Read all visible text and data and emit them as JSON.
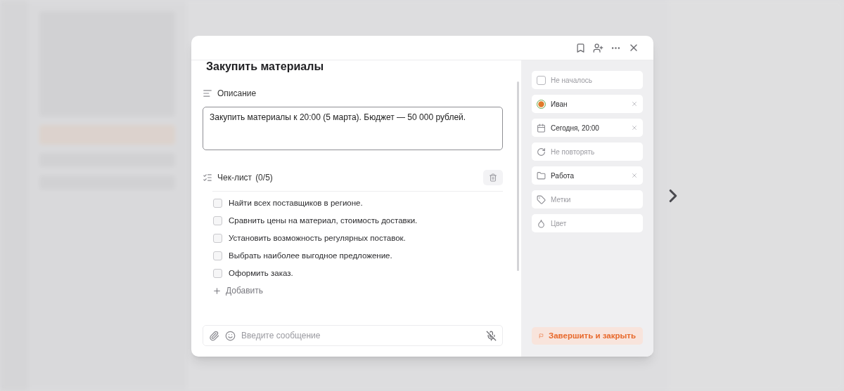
{
  "task": {
    "title": "Закупить материалы",
    "description": {
      "label": "Описание",
      "value": "Закупить материалы к 20:00 (5 марта). Бюджет — 50 000 рублей."
    },
    "checklist": {
      "label": "Чек-лист",
      "count": "(0/5)",
      "add_label": "Добавить",
      "items": [
        {
          "text": "Найти всех поставщиков в регионе.",
          "checked": false
        },
        {
          "text": "Сравнить цены на материал, стоимость доставки.",
          "checked": false
        },
        {
          "text": "Установить возможность регулярных поставок.",
          "checked": false
        },
        {
          "text": "Выбрать наиболее выгодное предложение.",
          "checked": false
        },
        {
          "text": "Оформить заказ.",
          "checked": false
        }
      ]
    },
    "message": {
      "placeholder": "Введите сообщение"
    }
  },
  "properties": [
    {
      "kind": "status",
      "text": "Не началось",
      "empty": true,
      "clearable": false,
      "checked": false
    },
    {
      "kind": "assignee",
      "text": "Иван",
      "empty": false,
      "clearable": true
    },
    {
      "kind": "due",
      "text": "Сегодня, 20:00",
      "empty": false,
      "clearable": true
    },
    {
      "kind": "repeat",
      "text": "Не повторять",
      "empty": true,
      "clearable": false
    },
    {
      "kind": "project",
      "text": "Работа",
      "empty": false,
      "clearable": true
    },
    {
      "kind": "tags",
      "text": "Метки",
      "empty": true,
      "clearable": false
    },
    {
      "kind": "color",
      "text": "Цвет",
      "empty": true,
      "clearable": false
    }
  ],
  "complete_button": "Завершить и закрыть"
}
